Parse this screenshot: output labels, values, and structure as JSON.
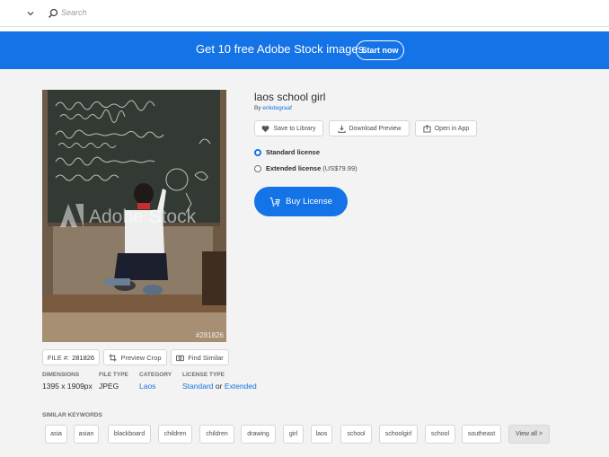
{
  "search": {
    "placeholder": "Search",
    "icon": "search-icon",
    "dropdown_icon": "chevron-down-icon"
  },
  "promo": {
    "text": "Get 10 free Adobe Stock images.",
    "button": "Start now",
    "color": "#1473e6"
  },
  "image": {
    "watermark": "Adobe Stock",
    "id_overlay": "#281826"
  },
  "image_actions": {
    "file_label": "FILE #:",
    "file_number": "281826",
    "preview_crop": "Preview Crop",
    "find_similar": "Find Similar"
  },
  "meta": {
    "dimensions_label": "DIMENSIONS",
    "dimensions": "1395 x 1909px",
    "file_type_label": "FILE TYPE",
    "file_type": "JPEG",
    "category_label": "CATEGORY",
    "category": "Laos",
    "license_type_label": "LICENSE TYPE",
    "license_standard": "Standard",
    "license_or": "or",
    "license_extended": "Extended"
  },
  "asset": {
    "title": "laos school girl",
    "by_label": "By",
    "author": "erikdegraaf"
  },
  "actions": {
    "save_to_library": "Save to Library",
    "download_preview": "Download Preview",
    "open_in_app": "Open in App"
  },
  "licenses": {
    "standard": "Standard license",
    "extended": "Extended license",
    "extended_price": "(US$79.99)",
    "selected": "standard"
  },
  "buy": {
    "label": "Buy License"
  },
  "keywords": {
    "title": "SIMILAR KEYWORDS",
    "items": [
      "asia",
      "asian",
      "blackboard",
      "children",
      "children",
      "drawing",
      "girl",
      "laos",
      "school",
      "schoolgirl",
      "school",
      "southeast"
    ],
    "view_all": "View all >"
  }
}
